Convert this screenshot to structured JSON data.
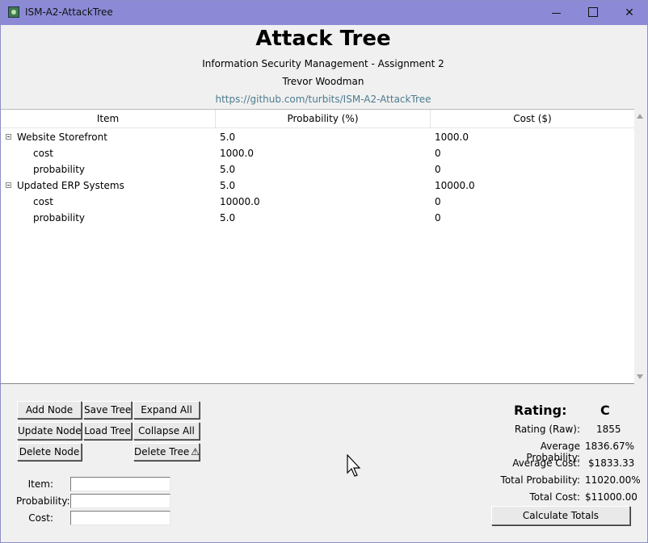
{
  "window": {
    "title": "ISM-A2-AttackTree",
    "icon": "app-icon",
    "controls": [
      "minimize-icon",
      "maximize-icon",
      "close-icon"
    ]
  },
  "header": {
    "title": "Attack Tree",
    "subtitle": "Information Security Management - Assignment 2",
    "author": "Trevor Woodman",
    "link": "https://github.com/turbits/ISM-A2-AttackTree"
  },
  "tree": {
    "columns": [
      "Item",
      "Probability (%)",
      "Cost ($)"
    ],
    "nodes": [
      {
        "item": "Website Storefront",
        "probability": "5.0",
        "cost": "1000.0",
        "children": [
          {
            "item": "cost",
            "probability": "1000.0",
            "cost": "0"
          },
          {
            "item": "probability",
            "probability": "5.0",
            "cost": "0"
          }
        ]
      },
      {
        "item": "Updated ERP Systems",
        "probability": "5.0",
        "cost": "10000.0",
        "children": [
          {
            "item": "cost",
            "probability": "10000.0",
            "cost": "0"
          },
          {
            "item": "probability",
            "probability": "5.0",
            "cost": "0"
          }
        ]
      }
    ]
  },
  "buttons": {
    "add_node": "Add Node",
    "save_tree": "Save Tree",
    "expand_all": "Expand All",
    "update_node": "Update Node",
    "load_tree": "Load Tree",
    "collapse_all": "Collapse All",
    "delete_node": "Delete Node",
    "delete_tree": "Delete Tree",
    "calculate_totals": "Calculate Totals"
  },
  "form": {
    "item_label": "Item:",
    "probability_label": "Probability:",
    "cost_label": "Cost:",
    "item_value": "",
    "probability_value": "",
    "cost_value": ""
  },
  "stats": {
    "rating_label": "Rating:",
    "rating_grade": "C",
    "rating_raw_label": "Rating (Raw):",
    "rating_raw": "1855",
    "avg_prob_label": "Average Probability:",
    "avg_prob": "1836.67%",
    "avg_cost_label": "Average Cost:",
    "avg_cost": "$1833.33",
    "total_prob_label": "Total Probability:",
    "total_prob": "11020.00%",
    "total_cost_label": "Total Cost:",
    "total_cost": "$11000.00"
  },
  "colors": {
    "titlebar": "#8c8ad6",
    "link": "#4c7b8f",
    "background": "#f0f0f0"
  }
}
